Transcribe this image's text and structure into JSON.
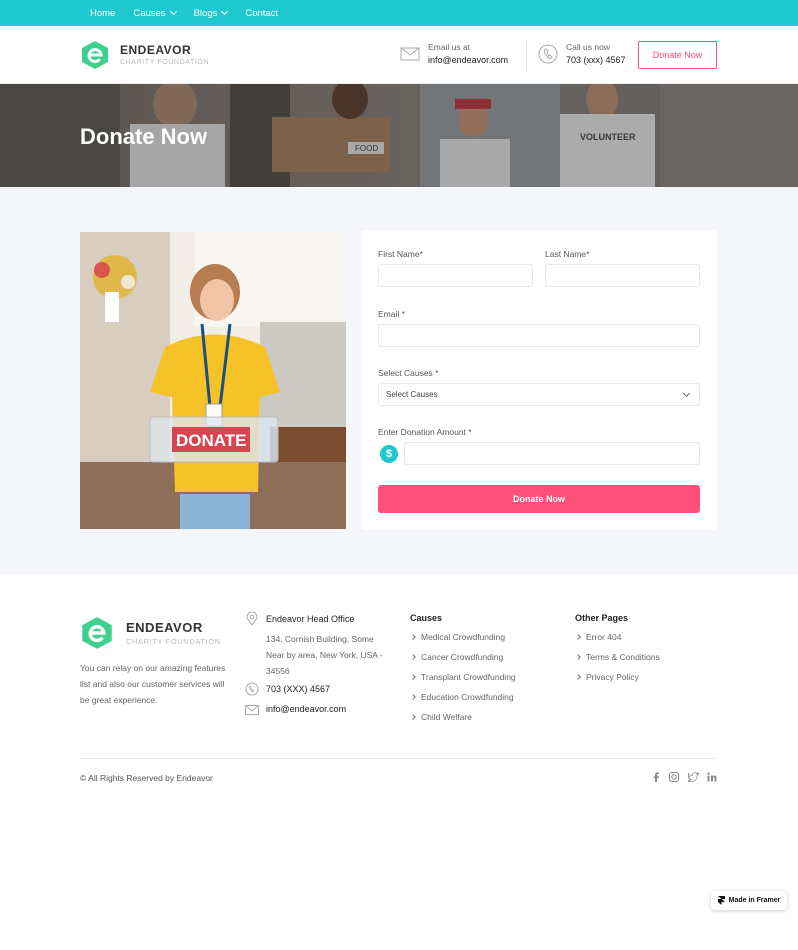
{
  "nav": {
    "items": [
      {
        "label": "Home",
        "dropdown": false
      },
      {
        "label": "Causes",
        "dropdown": true
      },
      {
        "label": "Blogs",
        "dropdown": true
      },
      {
        "label": "Contact",
        "dropdown": false
      }
    ]
  },
  "brand": {
    "name": "ENDEAVOR",
    "tagline": "CHARITY FOUNDATION",
    "accent": "#1fc7cf",
    "pink": "#ff4f7b"
  },
  "header": {
    "email_label": "Email us at",
    "email_value": "info@endeavor.com",
    "phone_label": "Call us now",
    "phone_value": "703 (xxx) 4567",
    "donate_button": "Donate Now"
  },
  "hero": {
    "title": "Donate Now",
    "photo_text": [
      "VOLUNTEER",
      "FOOD",
      "VOLUNTEER",
      "VOLUNTEER"
    ]
  },
  "photo": {
    "sign_text": "DONATE"
  },
  "form": {
    "first_name_label": "First Name*",
    "last_name_label": "Last Name*",
    "email_label": "Email *",
    "causes_label": "Select Causes *",
    "causes_selected": "Select Causes",
    "amount_label": "Enter Donation Amount *",
    "currency_symbol": "$",
    "submit_label": "Donate Now"
  },
  "footer": {
    "about": "You can relay on our amazing features list and also our customer services will be great experience.",
    "office_title": "Endeavor Head Office",
    "office_address": "134, Cornish Building, Some Near by area, New York, USA - 34556",
    "phone": "703 (XXX) 4567",
    "email": "info@endeavor.com",
    "causes_title": "Causes",
    "causes": [
      "Medical Crowdfunding",
      "Cancer Crowdfunding",
      "Transplant Crowdfunding",
      "Education Crowdfunding",
      "Child Welfare"
    ],
    "pages_title": "Other Pages",
    "pages": [
      "Error 404",
      "Terms & Conditions",
      "Privacy Policy"
    ],
    "copyright": "© All Rights Reserved by Endeavor",
    "social": [
      "facebook-icon",
      "instagram-icon",
      "twitter-icon",
      "linkedin-icon"
    ]
  },
  "framer_badge": "Made in Framer"
}
